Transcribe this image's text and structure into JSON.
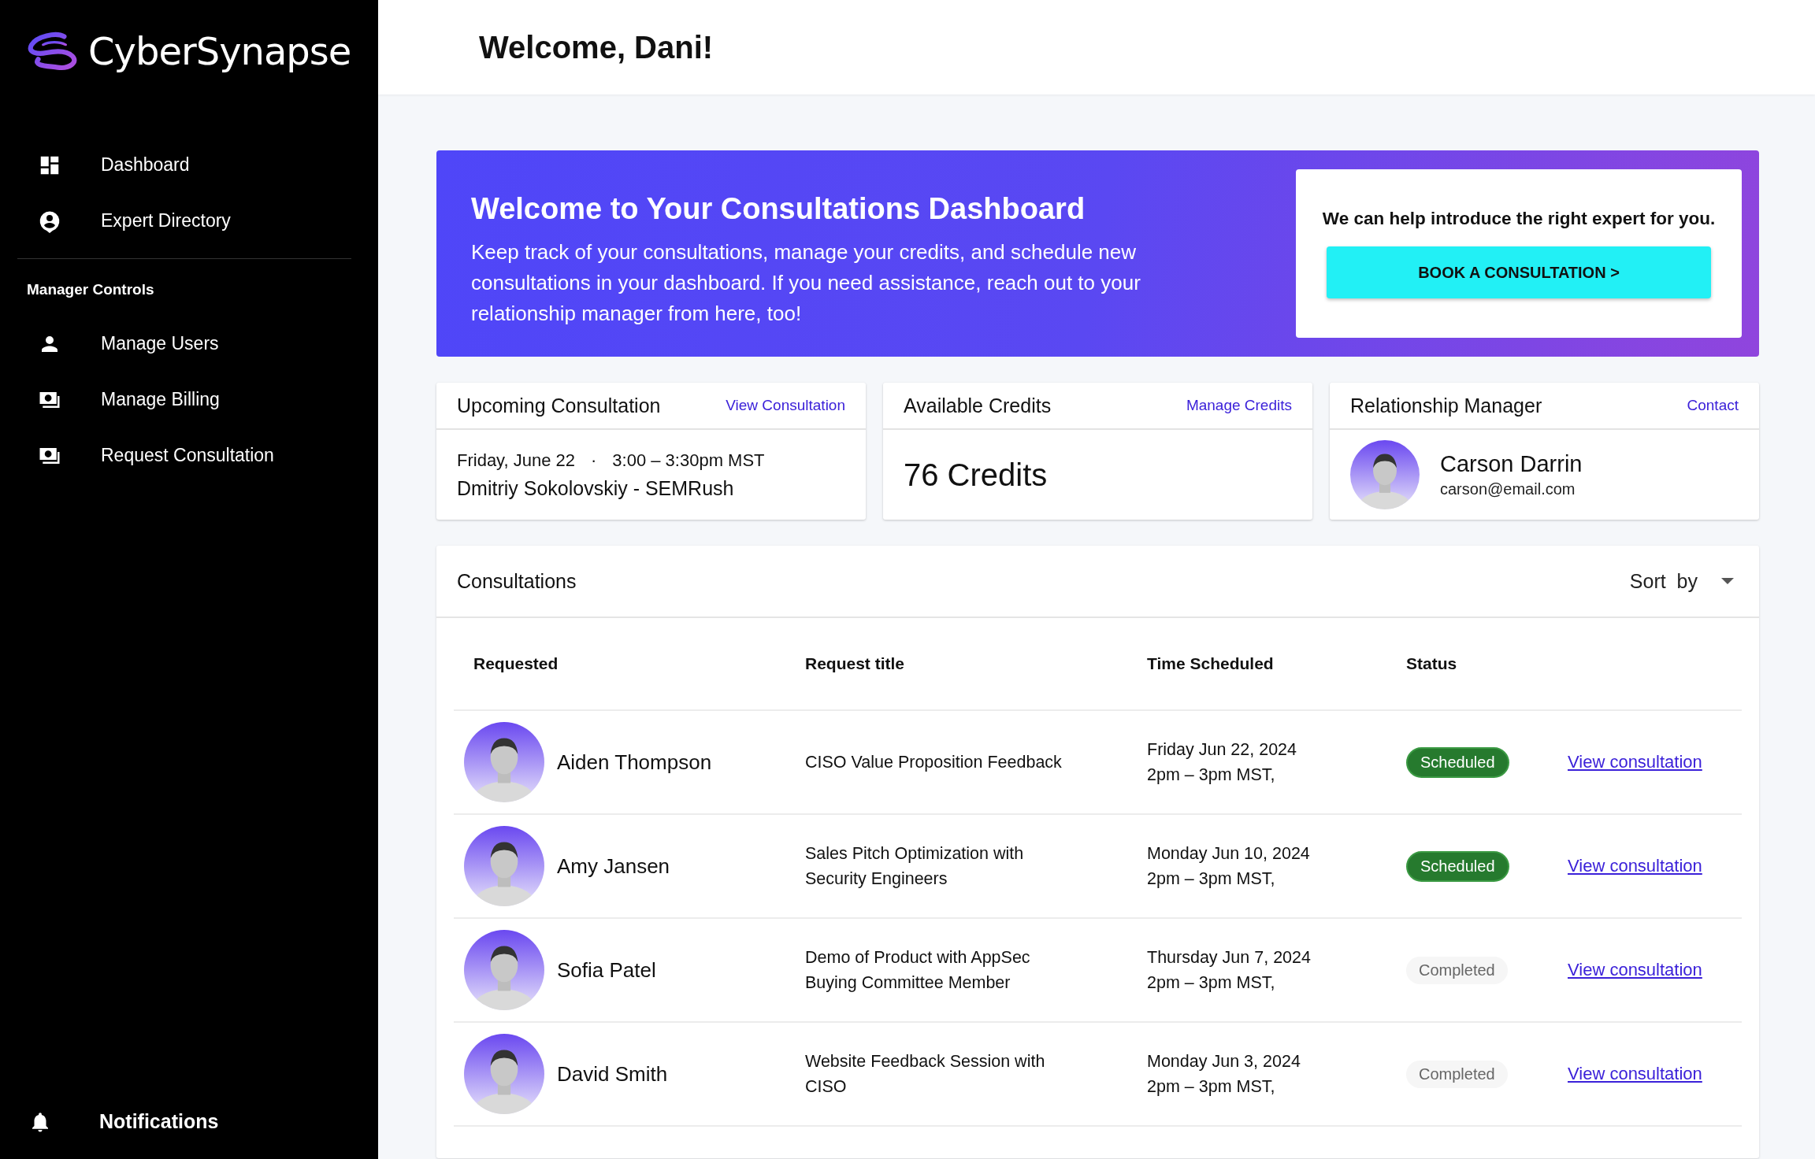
{
  "brand": {
    "name": "CyberSynapse"
  },
  "sidebar": {
    "items": [
      {
        "label": "Dashboard"
      },
      {
        "label": "Expert Directory"
      }
    ],
    "section_title": "Manager Controls",
    "manager_items": [
      {
        "label": "Manage Users"
      },
      {
        "label": "Manage Billing"
      },
      {
        "label": "Request Consultation"
      }
    ],
    "footer_item": {
      "label": "Notifications"
    }
  },
  "header": {
    "title": "Welcome, Dani!"
  },
  "banner": {
    "title": "Welcome to Your Consultations Dashboard",
    "text": "Keep track of your consultations, manage your credits, and schedule new consultations in your dashboard. If you need assistance, reach out to your relationship manager from here, too!",
    "cta_text": "We can help introduce the right expert for you.",
    "cta_button": "BOOK A CONSULTATION >"
  },
  "cards": [
    {
      "kind": "upcoming",
      "title": "Upcoming Consultation",
      "link": "View Consultation",
      "date": "Friday, June 22",
      "separator": "·",
      "time": "3:00 – 3:30pm MST",
      "name": "Dmitriy Sokolovskiy - SEMRush"
    },
    {
      "kind": "credits",
      "title": "Available Credits",
      "link": "Manage Credits",
      "value": "76 Credits"
    },
    {
      "kind": "manager",
      "title": "Relationship Manager",
      "link": "Contact",
      "name": "Carson Darrin",
      "email": "carson@email.com"
    }
  ],
  "consultations": {
    "title": "Consultations",
    "sort_label": "Sort  by",
    "columns": [
      "Requested",
      "Request title",
      "Time Scheduled",
      "Status"
    ],
    "rows": [
      {
        "name": "Aiden Thompson",
        "title": "CISO Value Proposition Feedback",
        "date": "Friday Jun 22, 2024",
        "time": "2pm – 3pm MST,",
        "status": {
          "label": "Scheduled",
          "kind": "scheduled"
        },
        "link": "View consultation"
      },
      {
        "name": "Amy Jansen",
        "title": "Sales Pitch Optimization with Security Engineers",
        "date": "Monday Jun 10, 2024",
        "time": "2pm – 3pm MST,",
        "status": {
          "label": "Scheduled",
          "kind": "scheduled"
        },
        "link": "View consultation"
      },
      {
        "name": "Sofia Patel",
        "title": "Demo of Product with AppSec Buying Committee Member",
        "date": "Thursday Jun 7, 2024",
        "time": "2pm – 3pm MST,",
        "status": {
          "label": "Completed",
          "kind": "completed"
        },
        "link": "View consultation"
      },
      {
        "name": "David Smith",
        "title": "Website Feedback Session with CISO",
        "date": "Monday Jun 3, 2024",
        "time": "2pm – 3pm MST,",
        "status": {
          "label": "Completed",
          "kind": "completed"
        },
        "link": "View consultation"
      }
    ]
  }
}
